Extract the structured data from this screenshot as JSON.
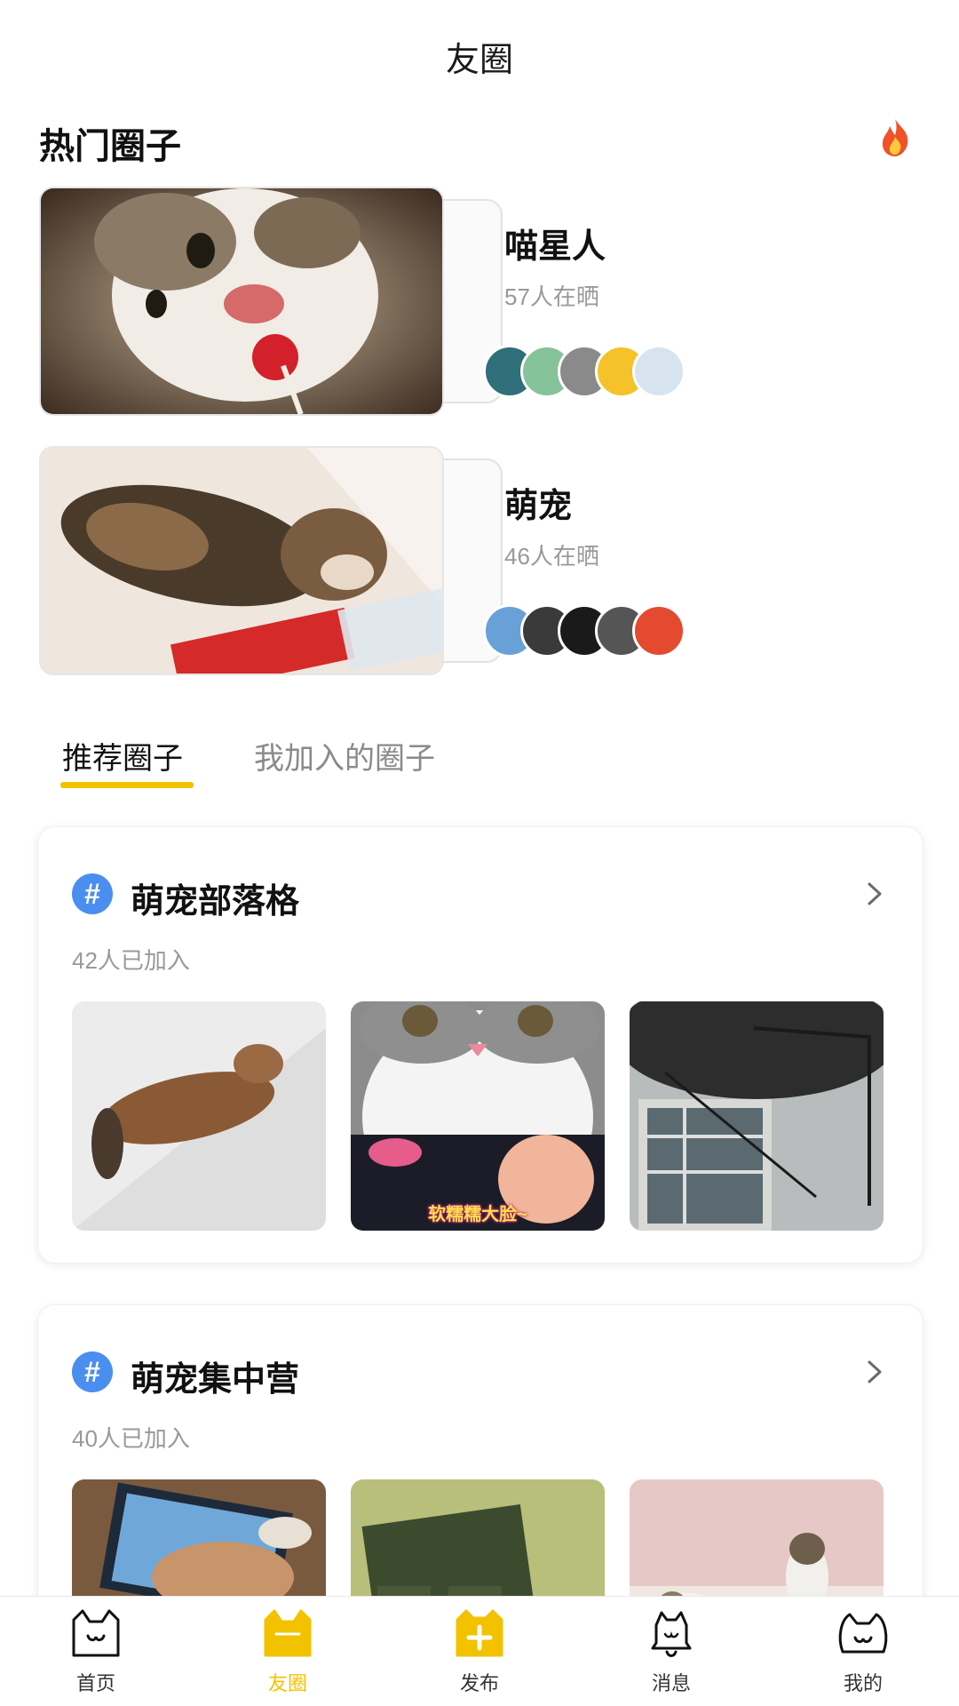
{
  "page": {
    "title": "友圈"
  },
  "hot": {
    "title": "热门圈子",
    "fire_icon": "fire-icon",
    "items": [
      {
        "name": "喵星人",
        "count": "57人在晒",
        "avatar_colors": [
          "#2f6f7a",
          "#86c29a",
          "#8a8a8a",
          "#f5c22a",
          "#d7e4f0"
        ]
      },
      {
        "name": "萌宠",
        "count": "46人在晒",
        "avatar_colors": [
          "#6aa0d8",
          "#3a3a3a",
          "#1a1a1a",
          "#555555",
          "#e34a2f"
        ]
      }
    ]
  },
  "tabs": {
    "recommend": "推荐圈子",
    "joined": "我加入的圈子",
    "active": "推荐圈子"
  },
  "groups": [
    {
      "name": "萌宠部落格",
      "members": "42人已加入",
      "thumb_caption": "软糯糯大脸~"
    },
    {
      "name": "萌宠集中营",
      "members": "40人已加入"
    }
  ],
  "nav": {
    "items": [
      {
        "label": "首页",
        "icon": "cat-home-icon"
      },
      {
        "label": "友圈",
        "icon": "cat-circle-icon",
        "active": true
      },
      {
        "label": "发布",
        "icon": "publish-plus-icon"
      },
      {
        "label": "消息",
        "icon": "cat-bell-icon"
      },
      {
        "label": "我的",
        "icon": "cat-profile-icon"
      }
    ],
    "accent": "#f2c200"
  },
  "colors": {
    "accent": "#f2c200",
    "hash_blue": "#4a8ef0",
    "muted": "#999999"
  }
}
